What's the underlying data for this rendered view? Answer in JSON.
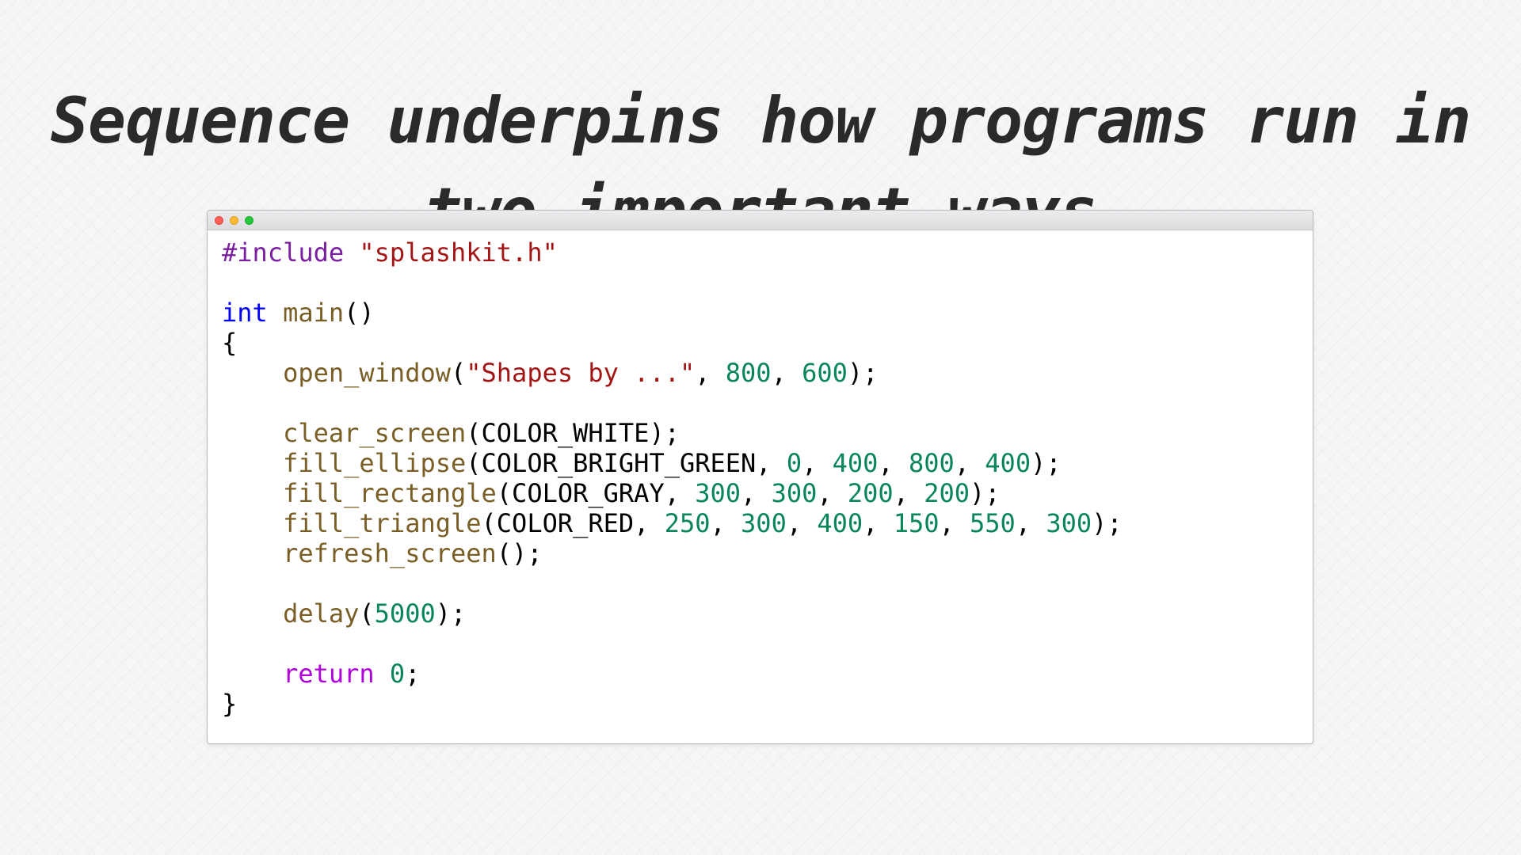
{
  "slide": {
    "title_line1": "Sequence underpins how programs run in",
    "title_line2_emphasis": "two",
    "title_line2_rest": " important ways"
  },
  "editor": {
    "window_buttons": [
      "close",
      "minimize",
      "maximize"
    ],
    "colors": {
      "preprocessor": "#7b1fa2",
      "string": "#a31515",
      "type": "#0000ff",
      "function": "#795e26",
      "number": "#098658",
      "keyword": "#af00db",
      "plain": "#000000"
    },
    "lines": [
      [
        {
          "t": "preproc",
          "v": "#include"
        },
        {
          "t": "plain",
          "v": " "
        },
        {
          "t": "string",
          "v": "\"splashkit.h\""
        }
      ],
      [],
      [
        {
          "t": "type",
          "v": "int"
        },
        {
          "t": "plain",
          "v": " "
        },
        {
          "t": "func",
          "v": "main"
        },
        {
          "t": "plain",
          "v": "()"
        }
      ],
      [
        {
          "t": "plain",
          "v": "{"
        }
      ],
      [
        {
          "t": "plain",
          "v": "    "
        },
        {
          "t": "func",
          "v": "open_window"
        },
        {
          "t": "plain",
          "v": "("
        },
        {
          "t": "string",
          "v": "\"Shapes by ...\""
        },
        {
          "t": "plain",
          "v": ", "
        },
        {
          "t": "num",
          "v": "800"
        },
        {
          "t": "plain",
          "v": ", "
        },
        {
          "t": "num",
          "v": "600"
        },
        {
          "t": "plain",
          "v": ");"
        }
      ],
      [],
      [
        {
          "t": "plain",
          "v": "    "
        },
        {
          "t": "func",
          "v": "clear_screen"
        },
        {
          "t": "plain",
          "v": "(COLOR_WHITE);"
        }
      ],
      [
        {
          "t": "plain",
          "v": "    "
        },
        {
          "t": "func",
          "v": "fill_ellipse"
        },
        {
          "t": "plain",
          "v": "(COLOR_BRIGHT_GREEN, "
        },
        {
          "t": "num",
          "v": "0"
        },
        {
          "t": "plain",
          "v": ", "
        },
        {
          "t": "num",
          "v": "400"
        },
        {
          "t": "plain",
          "v": ", "
        },
        {
          "t": "num",
          "v": "800"
        },
        {
          "t": "plain",
          "v": ", "
        },
        {
          "t": "num",
          "v": "400"
        },
        {
          "t": "plain",
          "v": ");"
        }
      ],
      [
        {
          "t": "plain",
          "v": "    "
        },
        {
          "t": "func",
          "v": "fill_rectangle"
        },
        {
          "t": "plain",
          "v": "(COLOR_GRAY, "
        },
        {
          "t": "num",
          "v": "300"
        },
        {
          "t": "plain",
          "v": ", "
        },
        {
          "t": "num",
          "v": "300"
        },
        {
          "t": "plain",
          "v": ", "
        },
        {
          "t": "num",
          "v": "200"
        },
        {
          "t": "plain",
          "v": ", "
        },
        {
          "t": "num",
          "v": "200"
        },
        {
          "t": "plain",
          "v": ");"
        }
      ],
      [
        {
          "t": "plain",
          "v": "    "
        },
        {
          "t": "func",
          "v": "fill_triangle"
        },
        {
          "t": "plain",
          "v": "(COLOR_RED, "
        },
        {
          "t": "num",
          "v": "250"
        },
        {
          "t": "plain",
          "v": ", "
        },
        {
          "t": "num",
          "v": "300"
        },
        {
          "t": "plain",
          "v": ", "
        },
        {
          "t": "num",
          "v": "400"
        },
        {
          "t": "plain",
          "v": ", "
        },
        {
          "t": "num",
          "v": "150"
        },
        {
          "t": "plain",
          "v": ", "
        },
        {
          "t": "num",
          "v": "550"
        },
        {
          "t": "plain",
          "v": ", "
        },
        {
          "t": "num",
          "v": "300"
        },
        {
          "t": "plain",
          "v": ");"
        }
      ],
      [
        {
          "t": "plain",
          "v": "    "
        },
        {
          "t": "func",
          "v": "refresh_screen"
        },
        {
          "t": "plain",
          "v": "();"
        }
      ],
      [],
      [
        {
          "t": "plain",
          "v": "    "
        },
        {
          "t": "func",
          "v": "delay"
        },
        {
          "t": "plain",
          "v": "("
        },
        {
          "t": "num",
          "v": "5000"
        },
        {
          "t": "plain",
          "v": ");"
        }
      ],
      [],
      [
        {
          "t": "plain",
          "v": "    "
        },
        {
          "t": "kw",
          "v": "return"
        },
        {
          "t": "plain",
          "v": " "
        },
        {
          "t": "num",
          "v": "0"
        },
        {
          "t": "plain",
          "v": ";"
        }
      ],
      [
        {
          "t": "plain",
          "v": "}"
        }
      ]
    ]
  }
}
